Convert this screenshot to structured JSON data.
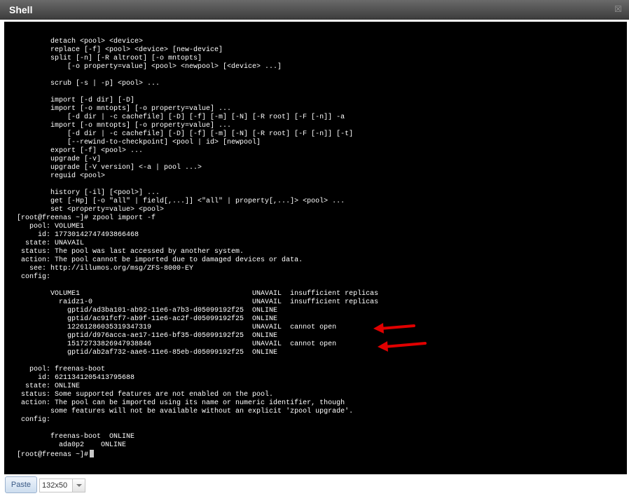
{
  "window": {
    "title": "Shell",
    "close_icon": "close-icon"
  },
  "terminal": {
    "background": "#000000",
    "foreground": "#ffffff",
    "text": "        detach <pool> <device>\n        replace [-f] <pool> <device> [new-device]\n        split [-n] [-R altroot] [-o mntopts]\n            [-o property=value] <pool> <newpool> [<device> ...]\n\n        scrub [-s | -p] <pool> ...\n\n        import [-d dir] [-D]\n        import [-o mntopts] [-o property=value] ...\n            [-d dir | -c cachefile] [-D] [-f] [-m] [-N] [-R root] [-F [-n]] -a\n        import [-o mntopts] [-o property=value] ...\n            [-d dir | -c cachefile] [-D] [-f] [-m] [-N] [-R root] [-F [-n]] [-t]\n            [--rewind-to-checkpoint] <pool | id> [newpool]\n        export [-f] <pool> ...\n        upgrade [-v]\n        upgrade [-V version] <-a | pool ...>\n        reguid <pool>\n\n        history [-il] [<pool>] ...\n        get [-Hp] [-o \"all\" | field[,...]] <\"all\" | property[,...]> <pool> ...\n        set <property=value> <pool>\n[root@freenas ~]# zpool import -f\n   pool: VOLUME1\n     id: 17730142747493866468\n  state: UNAVAIL\n status: The pool was last accessed by another system.\n action: The pool cannot be imported due to damaged devices or data.\n   see: http://illumos.org/msg/ZFS-8000-EY\n config:\n\n        VOLUME1                                         UNAVAIL  insufficient replicas\n          raidz1-0                                      UNAVAIL  insufficient replicas\n            gptid/ad3ba101-ab92-11e6-a7b3-d05099192f25  ONLINE\n            gptid/ac91fcf7-ab9f-11e6-ac2f-d05099192f25  ONLINE\n            12261286035319347319                        UNAVAIL  cannot open\n            gptid/d976acca-ae17-11e6-bf35-d05099192f25  ONLINE\n            15172733826947938846                        UNAVAIL  cannot open\n            gptid/ab2af732-aae6-11e6-85eb-d05099192f25  ONLINE\n\n   pool: freenas-boot\n     id: 6211341205413795688\n  state: ONLINE\n status: Some supported features are not enabled on the pool.\n action: The pool can be imported using its name or numeric identifier, though\n        some features will not be available without an explicit 'zpool upgrade'.\n config:\n\n        freenas-boot  ONLINE\n          ada0p2    ONLINE\n[root@freenas ~]#",
    "annotation_color": "#e00000"
  },
  "toolbar": {
    "paste_label": "Paste",
    "size_value": "132x50",
    "dropdown_icon": "chevron-down-icon"
  }
}
